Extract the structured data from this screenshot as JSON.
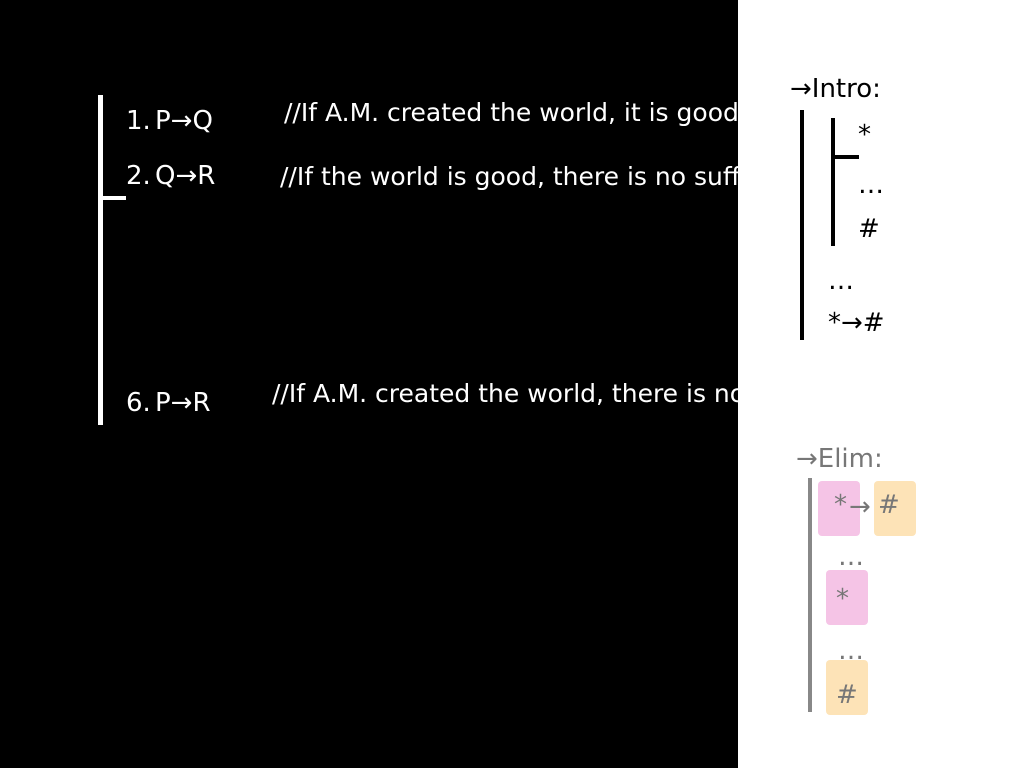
{
  "proof": {
    "line1": {
      "number": "1.",
      "formula": "P→Q",
      "comment": "//If A.M. created the world, it is good"
    },
    "line2": {
      "number": "2.",
      "formula": "Q→R",
      "comment": "//If the world is good, there is no suffering"
    },
    "line6": {
      "number": "6.",
      "formula": "P→R",
      "comment": "//If A.M. created the world, there is no suffering"
    }
  },
  "intro_rule": {
    "title": "→Intro:",
    "assumption": "*",
    "dots1": "…",
    "derived": "#",
    "dots2": "…",
    "conclusion": "*→#"
  },
  "elim_rule": {
    "title": "→Elim:",
    "premise_antecedent": "*",
    "premise_arrow": "→",
    "premise_consequent": "#",
    "dots1": "…",
    "antecedent": "*",
    "dots2": "…",
    "conclusion": "#",
    "colors": {
      "antecedent_highlight": "#f5c4e6",
      "consequent_highlight": "#fde3b7",
      "bar": "#888888"
    }
  }
}
